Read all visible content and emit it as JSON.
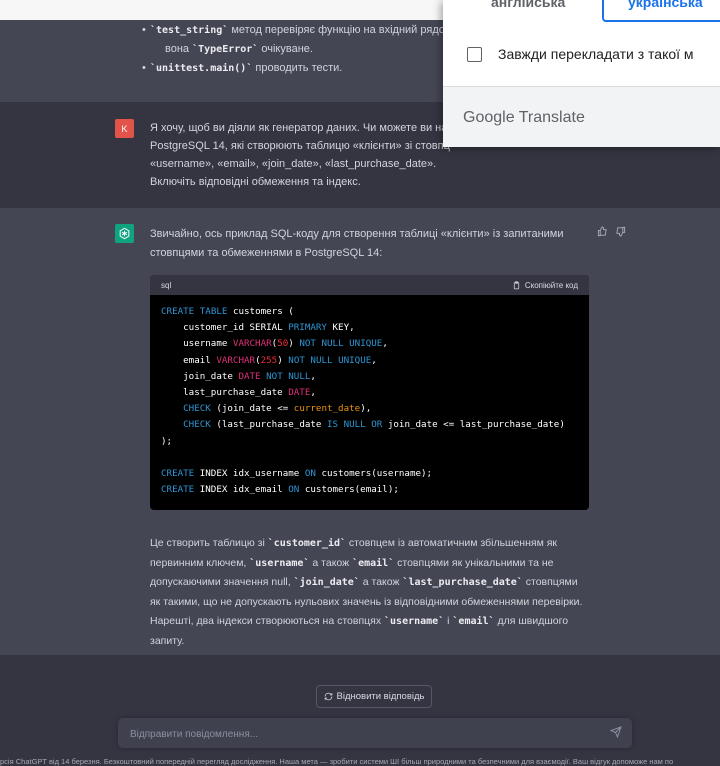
{
  "previous_message": {
    "items": [
      {
        "code": "`test_string`",
        "text": " метод перевіряє функцію на вхідний рядо"
      },
      {
        "code": "",
        "text": "вона ",
        "code2": "`TypeError`",
        "text2": " очікуване."
      },
      {
        "code": "`unittest.main()`",
        "text": " проводить тести."
      }
    ]
  },
  "user_message": {
    "avatar_letter": "K",
    "avatar_color": "#e2534a",
    "text": "Я хочу, щоб ви діяли як генератор даних. Чи можете ви на PostgreSQL 14, які створюють таблицю «клієнти» зі стовпц «username», «email», «join_date», «last_purchase_date». Включіть відповідні обмеження та індекс."
  },
  "assistant_message": {
    "avatar_color": "#10a37f",
    "intro": "Звичайно, ось приклад SQL-коду для створення таблиці «клієнти» із запитаними стовпцями та обмеженнями в PostgreSQL 14:",
    "code_lang": "sql",
    "copy_label": "Скопіюйте код",
    "outro_parts": [
      {
        "t": "Це створить таблицю зі "
      },
      {
        "c": "`customer_id`"
      },
      {
        "t": " стовпцем із автоматичним збільшенням як первинним ключем, "
      },
      {
        "c": "`username`"
      },
      {
        "t": " а також "
      },
      {
        "c": "`email`"
      },
      {
        "t": " стовпцями як унікальними та не допускаючими значення null, "
      },
      {
        "c": "`join_date`"
      },
      {
        "t": " а також "
      },
      {
        "c": "`last_purchase_date`"
      },
      {
        "t": " стовпцями як такими, що не допускають нульових значень із відповідними обмеженнями перевірки. Нарешті, два індекси створюються на стовпцях "
      },
      {
        "c": "`username`"
      },
      {
        "t": " і "
      },
      {
        "c": "`email`"
      },
      {
        "t": " для швидшого запиту."
      }
    ]
  },
  "code_lines": [
    [
      {
        "k": "kw",
        "t": "CREATE"
      },
      {
        "t": " "
      },
      {
        "k": "kw",
        "t": "TABLE"
      },
      {
        "t": " customers ("
      }
    ],
    [
      {
        "t": "    customer_id SERIAL "
      },
      {
        "k": "kw",
        "t": "PRIMARY"
      },
      {
        "t": " KEY,"
      }
    ],
    [
      {
        "t": "    username "
      },
      {
        "k": "ty",
        "t": "VARCHAR"
      },
      {
        "t": "("
      },
      {
        "k": "fn",
        "t": "50"
      },
      {
        "t": ") "
      },
      {
        "k": "kw",
        "t": "NOT NULL UNIQUE"
      },
      {
        "t": ","
      }
    ],
    [
      {
        "t": "    email "
      },
      {
        "k": "ty",
        "t": "VARCHAR"
      },
      {
        "t": "("
      },
      {
        "k": "fn",
        "t": "255"
      },
      {
        "t": ") "
      },
      {
        "k": "kw",
        "t": "NOT NULL UNIQUE"
      },
      {
        "t": ","
      }
    ],
    [
      {
        "t": "    join_date "
      },
      {
        "k": "ty",
        "t": "DATE"
      },
      {
        "t": " "
      },
      {
        "k": "kw",
        "t": "NOT NULL"
      },
      {
        "t": ","
      }
    ],
    [
      {
        "t": "    last_purchase_date "
      },
      {
        "k": "ty",
        "t": "DATE"
      },
      {
        "t": ","
      }
    ],
    [
      {
        "t": "    "
      },
      {
        "k": "kw",
        "t": "CHECK"
      },
      {
        "t": " (join_date <= "
      },
      {
        "k": "fo",
        "t": "current_date"
      },
      {
        "t": "),"
      }
    ],
    [
      {
        "t": "    "
      },
      {
        "k": "kw",
        "t": "CHECK"
      },
      {
        "t": " (last_purchase_date "
      },
      {
        "k": "kw",
        "t": "IS NULL OR"
      },
      {
        "t": " join_date <= last_purchase_date)"
      }
    ],
    [
      {
        "t": ");"
      }
    ],
    [
      {
        "t": ""
      }
    ],
    [
      {
        "k": "kw",
        "t": "CREATE"
      },
      {
        "t": " INDEX idx_username "
      },
      {
        "k": "kw",
        "t": "ON"
      },
      {
        "t": " customers(username);"
      }
    ],
    [
      {
        "k": "kw",
        "t": "CREATE"
      },
      {
        "t": " INDEX idx_email "
      },
      {
        "k": "kw",
        "t": "ON"
      },
      {
        "t": " customers(email);"
      }
    ]
  ],
  "composer": {
    "regenerate_label": "Відновити відповідь",
    "placeholder": "Відправити повідомлення..."
  },
  "footer_text": "рсія ChatGPT від 14 березня. Безкоштовний попередній перегляд дослідження. Наша мета — зробити системи ШІ більш природними та безпечними для взаємодії. Ваш відгук допоможе нам по",
  "translate_popup": {
    "tab_source": "англійська",
    "tab_target": "українська",
    "always_translate": "Завжди перекладати з такої м",
    "brand": "Google Translate"
  }
}
